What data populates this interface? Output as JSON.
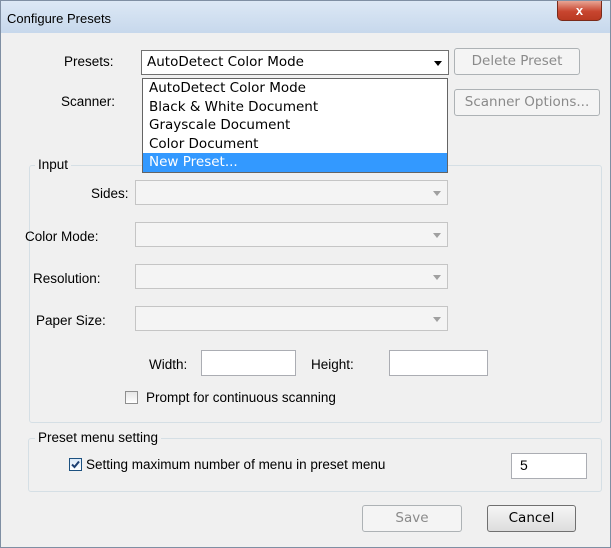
{
  "window": {
    "title": "Configure Presets",
    "close_glyph": "x"
  },
  "presets": {
    "label": "Presets:",
    "selected": "AutoDetect Color Mode",
    "delete_label": "Delete Preset",
    "options": [
      "AutoDetect Color Mode",
      "Black & White Document",
      "Grayscale Document",
      "Color Document",
      "New Preset..."
    ],
    "highlighted_index": 4
  },
  "scanner": {
    "label": "Scanner:",
    "options_label": "Scanner Options..."
  },
  "input_group": {
    "legend": "Input",
    "sides_label": "Sides:",
    "color_mode_label": "Color Mode:",
    "resolution_label": "Resolution:",
    "paper_size_label": "Paper Size:",
    "width_label": "Width:",
    "height_label": "Height:",
    "width_value": "",
    "height_value": "",
    "prompt_label": "Prompt for continuous scanning",
    "prompt_checked": false
  },
  "menu_group": {
    "legend": "Preset menu setting",
    "max_label": "Setting maximum number of menu in preset menu",
    "max_checked": true,
    "max_value": "5"
  },
  "footer": {
    "save_label": "Save",
    "cancel_label": "Cancel"
  },
  "colors": {
    "highlight": "#3399ff",
    "window_bg": "#f0f0f0",
    "close_button": "#c8452f"
  }
}
